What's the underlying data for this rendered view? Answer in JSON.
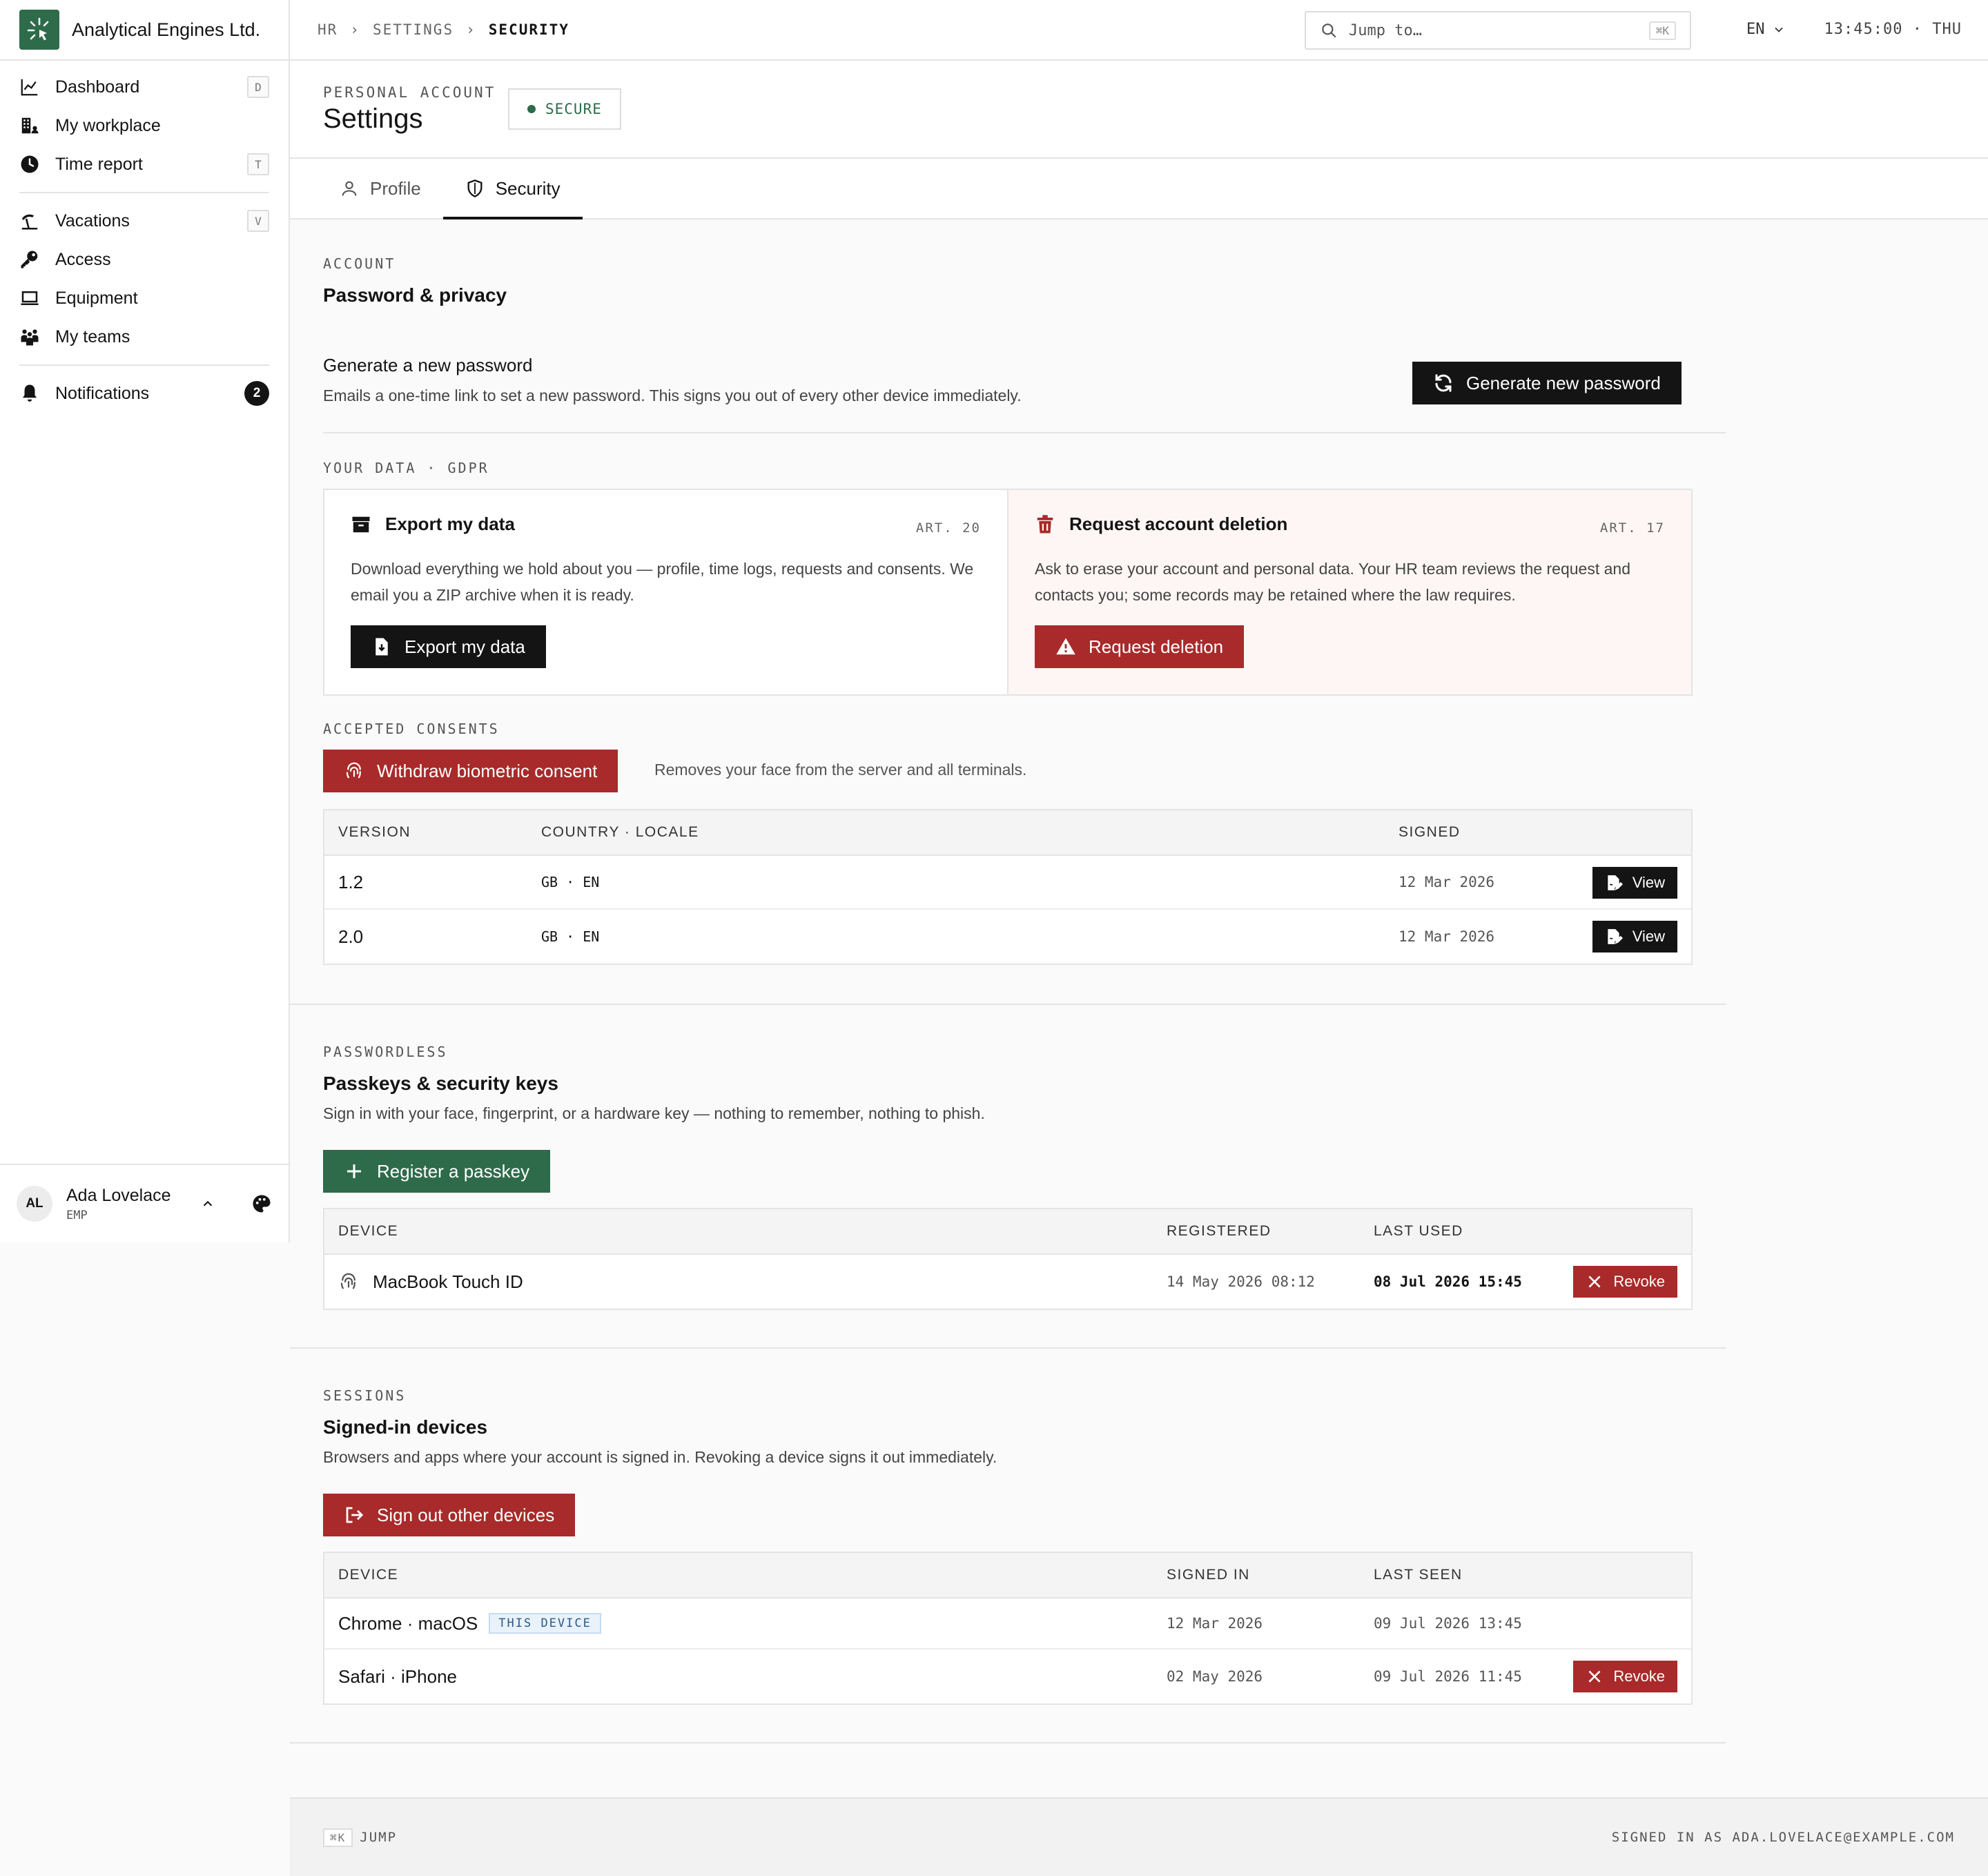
{
  "brand": {
    "name": "Analytical Engines Ltd.",
    "accent": "#2e6b4a"
  },
  "sidebar": {
    "items": [
      {
        "label": "Dashboard",
        "kbd": "D",
        "icon": "chart-icon"
      },
      {
        "label": "My workplace",
        "kbd": "",
        "icon": "building-icon"
      },
      {
        "label": "Time report",
        "kbd": "T",
        "icon": "clock-icon"
      },
      {
        "label": "Vacations",
        "kbd": "V",
        "icon": "beach-icon"
      },
      {
        "label": "Access",
        "kbd": "",
        "icon": "key-icon"
      },
      {
        "label": "Equipment",
        "kbd": "",
        "icon": "laptop-icon"
      },
      {
        "label": "My teams",
        "kbd": "",
        "icon": "team-icon"
      },
      {
        "label": "Notifications",
        "count": "2",
        "icon": "bell-icon"
      }
    ],
    "user": {
      "initials": "AL",
      "name": "Ada Lovelace",
      "role": "EMP"
    }
  },
  "topbar": {
    "crumbs": [
      "HR",
      "SETTINGS",
      "SECURITY"
    ],
    "search_placeholder": "Jump to…",
    "search_kbd": "⌘K",
    "lang": "EN",
    "clock": "13:45:00 · THU"
  },
  "header": {
    "eyebrow": "PERSONAL ACCOUNT",
    "title": "Settings",
    "badge": "SECURE"
  },
  "tabs": [
    {
      "label": "Profile"
    },
    {
      "label": "Security"
    }
  ],
  "account": {
    "eyebrow": "ACCOUNT",
    "title": "Password & privacy",
    "password": {
      "title": "Generate a new password",
      "desc": "Emails a one-time link to set a new password. This signs you out of every other device immediately.",
      "button": "Generate new password"
    },
    "gdpr_eyebrow": "YOUR DATA · GDPR",
    "export": {
      "title": "Export my data",
      "art": "ART. 20",
      "text": "Download everything we hold about you — profile, time logs, requests and consents. We email you a ZIP archive when it is ready.",
      "button": "Export my data"
    },
    "deletion": {
      "title": "Request account deletion",
      "art": "ART. 17",
      "text": "Ask to erase your account and personal data. Your HR team reviews the request and contacts you; some records may be retained where the law requires.",
      "button": "Request deletion"
    },
    "consents_eyebrow": "ACCEPTED CONSENTS",
    "withdraw_button": "Withdraw biometric consent",
    "withdraw_note": "Removes your face from the server and all terminals.",
    "consents_table": {
      "headers": [
        "VERSION",
        "COUNTRY · LOCALE",
        "SIGNED"
      ],
      "rows": [
        {
          "version": "1.2",
          "locale": "GB · EN",
          "signed": "12 Mar 2026",
          "action": "View"
        },
        {
          "version": "2.0",
          "locale": "GB · EN",
          "signed": "12 Mar 2026",
          "action": "View"
        }
      ]
    }
  },
  "passkeys": {
    "eyebrow": "PASSWORDLESS",
    "title": "Passkeys & security keys",
    "desc": "Sign in with your face, fingerprint, or a hardware key — nothing to remember, nothing to phish.",
    "button": "Register a passkey",
    "headers": [
      "DEVICE",
      "REGISTERED",
      "LAST USED"
    ],
    "rows": [
      {
        "device": "MacBook Touch ID",
        "registered": "14 May 2026 08:12",
        "last_used": "08 Jul 2026 15:45",
        "action": "Revoke"
      }
    ]
  },
  "sessions": {
    "eyebrow": "SESSIONS",
    "title": "Signed-in devices",
    "desc": "Browsers and apps where your account is signed in. Revoking a device signs it out immediately.",
    "button": "Sign out other devices",
    "headers": [
      "DEVICE",
      "SIGNED IN",
      "LAST SEEN"
    ],
    "rows": [
      {
        "device": "Chrome · macOS",
        "tag": "THIS DEVICE",
        "signed_in": "12 Mar 2026",
        "last_seen": "09 Jul 2026 13:45"
      },
      {
        "device": "Safari · iPhone",
        "signed_in": "02 May 2026",
        "last_seen": "09 Jul 2026 11:45",
        "action": "Revoke"
      }
    ]
  },
  "footer": {
    "kbd": "⌘K",
    "jump": "JUMP",
    "signed_in": "SIGNED IN AS ADA.LOVELACE@EXAMPLE.COM"
  }
}
